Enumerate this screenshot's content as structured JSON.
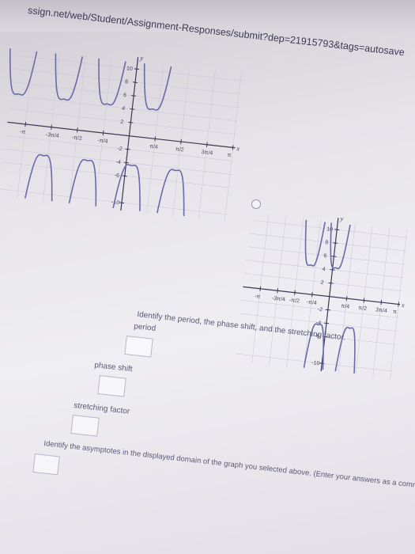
{
  "browser": {
    "url": "ssign.net/web/Student/Assignment-Responses/submit?dep=21915793&tags=autosave"
  },
  "graphs": [
    {
      "axis_x": "x",
      "axis_y": "y",
      "y_ticks": [
        "10",
        "8",
        "6",
        "4",
        "2",
        "-2",
        "-4",
        "-6",
        "-10"
      ],
      "x_ticks": [
        "-π",
        "-3π/4",
        "-π/2",
        "-π/4",
        "π/4",
        "π/2",
        "3π/4",
        "π"
      ]
    },
    {
      "axis_x": "x",
      "axis_y": "y",
      "y_ticks": [
        "10",
        "8",
        "6",
        "4",
        "2",
        "-2",
        "-4",
        "-6",
        "-10"
      ],
      "x_ticks": [
        "-π",
        "-3π/4",
        "-π/2",
        "-π/4",
        "π/4",
        "π/2",
        "3π/4",
        "π"
      ]
    }
  ],
  "question1": {
    "prompt": "Identify the period, the phase shift, and the stretching factor.",
    "period_label": "period",
    "phase_shift_label": "phase shift",
    "stretching_factor_label": "stretching factor",
    "period_value": "",
    "phase_shift_value": "",
    "stretching_factor_value": ""
  },
  "question2": {
    "prompt": "Identify the asymptotes in the displayed domain of the graph you selected above. (Enter your answers as a comma-separated list of equations.)",
    "answer_value": ""
  },
  "colors": {
    "curve": "#6b6aa8",
    "axis": "#3a3955",
    "grid": "#b9b8cf",
    "text": "#5b5a76"
  }
}
